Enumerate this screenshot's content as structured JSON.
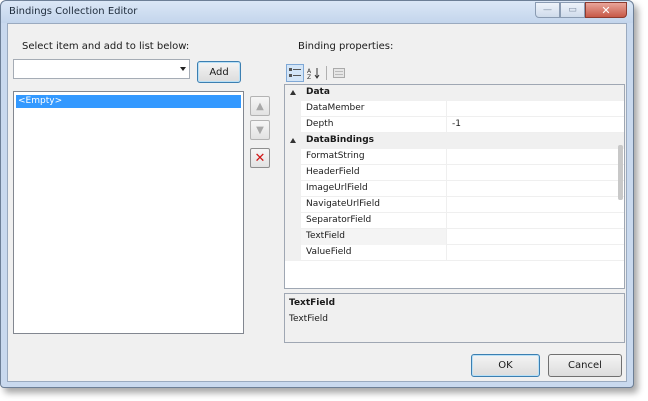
{
  "window": {
    "title": "Bindings Collection Editor",
    "minimize_glyph": "—",
    "maximize_glyph": "▭",
    "close_glyph": "✕"
  },
  "left": {
    "select_label": "Select item and add to list below:",
    "combo_value": "",
    "add_label": "Add",
    "items": [
      "<Empty>"
    ],
    "move_up_icon": "up-arrow-icon",
    "move_down_icon": "down-arrow-icon",
    "delete_icon": "red-x-icon"
  },
  "right": {
    "properties_label": "Binding properties:",
    "toolbar": {
      "categorized_icon": "categorized-icon",
      "alphabetical_icon": "alphabetical-sort-icon",
      "property_pages_icon": "property-pages-icon"
    },
    "categories": [
      {
        "name": "Data",
        "properties": [
          {
            "name": "DataMember",
            "value": ""
          },
          {
            "name": "Depth",
            "value": "-1"
          }
        ]
      },
      {
        "name": "DataBindings",
        "properties": [
          {
            "name": "FormatString",
            "value": ""
          },
          {
            "name": "HeaderField",
            "value": ""
          },
          {
            "name": "ImageUrlField",
            "value": ""
          },
          {
            "name": "NavigateUrlField",
            "value": ""
          },
          {
            "name": "SeparatorField",
            "value": ""
          },
          {
            "name": "TextField",
            "value": ""
          },
          {
            "name": "ValueField",
            "value": ""
          }
        ]
      }
    ],
    "help": {
      "title": "TextField",
      "description": "TextField"
    }
  },
  "footer": {
    "ok_label": "OK",
    "cancel_label": "Cancel"
  },
  "colors": {
    "selection": "#3399ff",
    "delete": "#d01616",
    "close_button": "#c75947"
  }
}
